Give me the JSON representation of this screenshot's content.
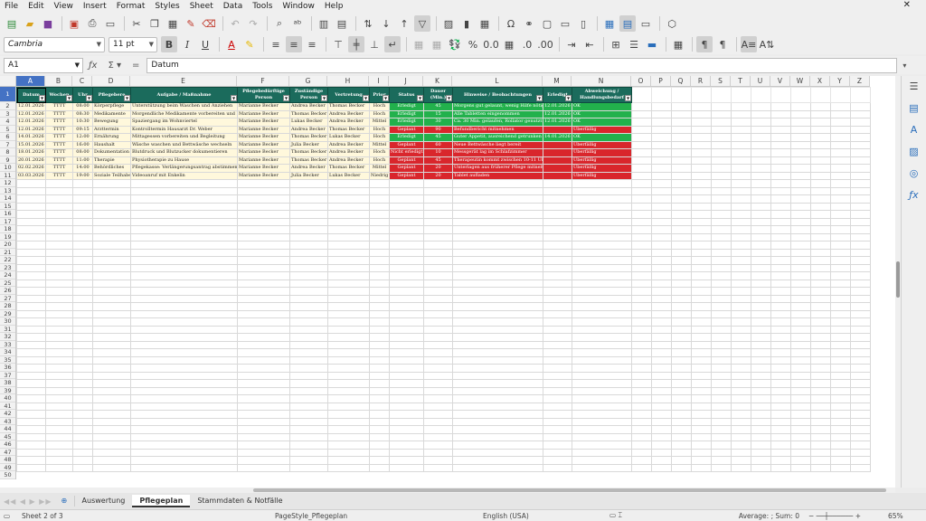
{
  "menu": [
    "File",
    "Edit",
    "View",
    "Insert",
    "Format",
    "Styles",
    "Sheet",
    "Data",
    "Tools",
    "Window",
    "Help"
  ],
  "font": {
    "name": "Cambria",
    "size": "11 pt"
  },
  "cell_ref": "A1",
  "formula_value": "Datum",
  "columns": [
    "A",
    "B",
    "C",
    "D",
    "E",
    "F",
    "G",
    "H",
    "I",
    "J",
    "K",
    "L",
    "M",
    "N",
    "O",
    "P",
    "Q",
    "R",
    "S",
    "T",
    "U",
    "V",
    "W",
    "X",
    "Y",
    "Z"
  ],
  "headers": [
    "Datum",
    "Wochen",
    "Uhr",
    "Pflegebere",
    "Aufgabe / Maßnahme",
    "Pflegebedürftige Person",
    "Zuständige Person",
    "Vertretung",
    "Prior",
    "Status",
    "Dauer (Min.)",
    "Hinweise / Beobachtungen",
    "Erledigt",
    "Abweichung / Handlungsbedarf"
  ],
  "rows": [
    {
      "c": [
        "12.01.2026",
        "TTTT",
        "08:00",
        "Körperpflege",
        "Unterstützung beim Waschen und Anziehen",
        "Marianne Becker",
        "Andrea Becker",
        "Thomas Becker",
        "Hoch",
        "Erledigt",
        "45",
        "Morgens gut gelaunt, wenig Hilfe nötig",
        "12.01.2026",
        "OK"
      ],
      "s": "green"
    },
    {
      "c": [
        "12.01.2026",
        "TTTT",
        "08:30",
        "Medikamente",
        "Morgendliche Medikamente vorbereiten und Einnahme begleiten",
        "Marianne Becker",
        "Thomas Becker",
        "Andrea Becker",
        "Hoch",
        "Erledigt",
        "15",
        "Alle Tabletten eingenommen",
        "12.01.2026",
        "OK"
      ],
      "s": "green"
    },
    {
      "c": [
        "12.01.2026",
        "TTTT",
        "10:30",
        "Bewegung",
        "Spaziergang im Wohnviertel",
        "Marianne Becker",
        "Lukas Becker",
        "Andrea Becker",
        "Mittel",
        "Erledigt",
        "30",
        "Ca. 30 Min. gelaufen, Rollator genutzt",
        "12.01.2026",
        "OK"
      ],
      "s": "green"
    },
    {
      "c": [
        "12.01.2026",
        "TTTT",
        "09:15",
        "Arzttermin",
        "Kontrolltermin Hausarzt Dr. Weber",
        "Marianne Becker",
        "Andrea Becker",
        "Thomas Becker",
        "Hoch",
        "Geplant",
        "90",
        "Befundbericht mitnehmen",
        "",
        "Überfällig"
      ],
      "s": "red"
    },
    {
      "c": [
        "14.01.2026",
        "TTTT",
        "12:00",
        "Ernährung",
        "Mittagessen vorbereiten und Begleitung",
        "Marianne Becker",
        "Thomas Becker",
        "Lukas Becker",
        "Hoch",
        "Erledigt",
        "45",
        "Guter Appetit, ausreichend getrunken",
        "14.01.2026",
        "OK"
      ],
      "s": "green"
    },
    {
      "c": [
        "15.01.2026",
        "TTTT",
        "16:00",
        "Haushalt",
        "Wäsche waschen und Bettwäsche wechseln",
        "Marianne Becker",
        "Julia Becker",
        "Andrea Becker",
        "Mittel",
        "Geplant",
        "60",
        "Neue Bettwäsche liegt bereit",
        "",
        "Überfällig"
      ],
      "s": "red"
    },
    {
      "c": [
        "18.01.2026",
        "TTTT",
        "08:00",
        "Dokumentation",
        "Blutdruck und Blutzucker dokumentieren",
        "Marianne Becker",
        "Thomas Becker",
        "Andrea Becker",
        "Hoch",
        "Nicht erledigt",
        "10",
        "Messgerät lag im Schlafzimmer",
        "",
        "Überfällig"
      ],
      "s": "red"
    },
    {
      "c": [
        "20.01.2026",
        "TTTT",
        "11:00",
        "Therapie",
        "Physiotherapie zu Hause",
        "Marianne Becker",
        "Thomas Becker",
        "Andrea Becker",
        "Hoch",
        "Geplant",
        "45",
        "Therapeutin kommt zwischen 10-11 Uhr",
        "",
        "Überfällig"
      ],
      "s": "red"
    },
    {
      "c": [
        "02.02.2026",
        "TTTT",
        "14:00",
        "Behördliches",
        "Pflegekasse: Verlängerungsantrag abstimmen",
        "Marianne Becker",
        "Andrea Becker",
        "Thomas Becker",
        "Mittel",
        "Geplant",
        "20",
        "Unterlagen aus früherer Pflege mitnehmen",
        "",
        "Überfällig"
      ],
      "s": "red"
    },
    {
      "c": [
        "03.03.2026",
        "TTTT",
        "19:00",
        "Soziale Teilhabe",
        "Videoanruf mit Enkelin",
        "Marianne Becker",
        "Julia Becker",
        "Lukas Becker",
        "Niedrig",
        "Geplant",
        "20",
        "Tablet aufladen",
        "",
        "Überfällig"
      ],
      "s": "red"
    }
  ],
  "tabs": [
    "Auswertung",
    "Pflegeplan",
    "Stammdaten & Notfälle"
  ],
  "active_tab": "Pflegeplan",
  "status": {
    "sheet": "Sheet 2 of 3",
    "pagestyle": "PageStyle_Pflegeplan",
    "language": "English (USA)",
    "summary": "Average: ; Sum: 0",
    "zoom": "65%"
  }
}
